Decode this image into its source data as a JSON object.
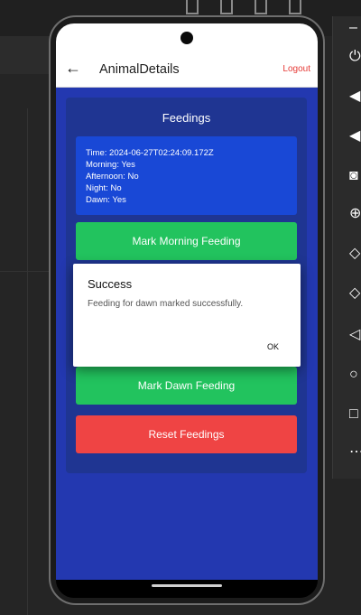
{
  "app": {
    "title": "AnimalDetails",
    "logout_label": "Logout",
    "back_icon": "arrow-left-icon",
    "back_glyph": "←"
  },
  "feedings": {
    "title": "Feedings",
    "info": {
      "time": "Time: 2024-06-27T02:24:09.172Z",
      "morning": "Morning: Yes",
      "afternoon": "Afternoon: No",
      "night": "Night: No",
      "dawn": "Dawn: Yes"
    },
    "buttons": {
      "morning": "Mark Morning Feeding",
      "dawn": "Mark Dawn Feeding",
      "reset": "Reset Feedings"
    }
  },
  "dialog": {
    "title": "Success",
    "message": "Feeding for dawn marked successfully.",
    "ok_label": "OK"
  },
  "emulator_toolbar": {
    "items": [
      "minimize-icon",
      "power-icon",
      "volume-up-icon",
      "volume-down-icon",
      "camera-icon",
      "zoom-icon",
      "rotate-left-icon",
      "rotate-right-icon",
      "back-icon",
      "home-icon",
      "overview-icon",
      "more-icon"
    ],
    "glyphs": {
      "minimize": "–",
      "power": "⏻",
      "volume_up": "◀",
      "volume_down": "◀",
      "camera": "◙",
      "zoom": "⊕",
      "rotate_left": "◇",
      "rotate_right": "◇",
      "back": "◁",
      "home": "○",
      "overview": "□",
      "more": "⋯"
    }
  },
  "colors": {
    "content_bg": "#2338b0",
    "card_bg": "#1f3592",
    "info_bg": "#1948d6",
    "green": "#22c35e",
    "red": "#ef4444",
    "logout": "#e53935"
  }
}
